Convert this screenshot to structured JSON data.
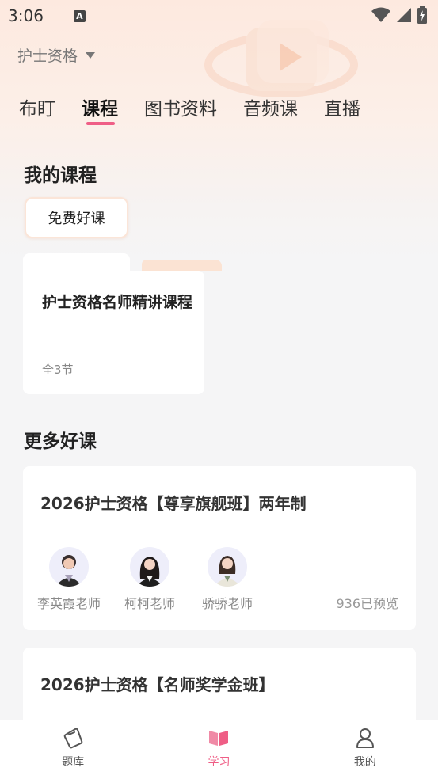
{
  "status_bar": {
    "time": "3:06",
    "notification_letter": "A"
  },
  "header": {
    "cert_selector_label": "护士资格"
  },
  "tabs": [
    {
      "label": "布盯",
      "active": false
    },
    {
      "label": "课程",
      "active": true
    },
    {
      "label": "图书资料",
      "active": false
    },
    {
      "label": "音频课",
      "active": false
    },
    {
      "label": "直播",
      "active": false
    }
  ],
  "my_courses": {
    "title": "我的课程",
    "filter_chip": "免费好课",
    "folder": {
      "title": "护士资格名师精讲课程",
      "count": "全3节"
    }
  },
  "more_courses": {
    "title": "更多好课",
    "cards": [
      {
        "title": "2026护士资格【尊享旗舰班】两年制",
        "teachers": [
          "李英霞老师",
          "柯柯老师",
          "骄骄老师"
        ],
        "preview_count": "936已预览"
      },
      {
        "title": "2026护士资格【名师奖学金班】"
      }
    ]
  },
  "bottom_nav": [
    {
      "label": "题库",
      "icon": "question-bank-icon",
      "active": false
    },
    {
      "label": "学习",
      "icon": "study-book-icon",
      "active": true
    },
    {
      "label": "我的",
      "icon": "profile-icon",
      "active": false
    }
  ],
  "colors": {
    "accent": "#ef5e86",
    "header_gradient_top": "#fde9df",
    "background": "#f5f5f6"
  }
}
